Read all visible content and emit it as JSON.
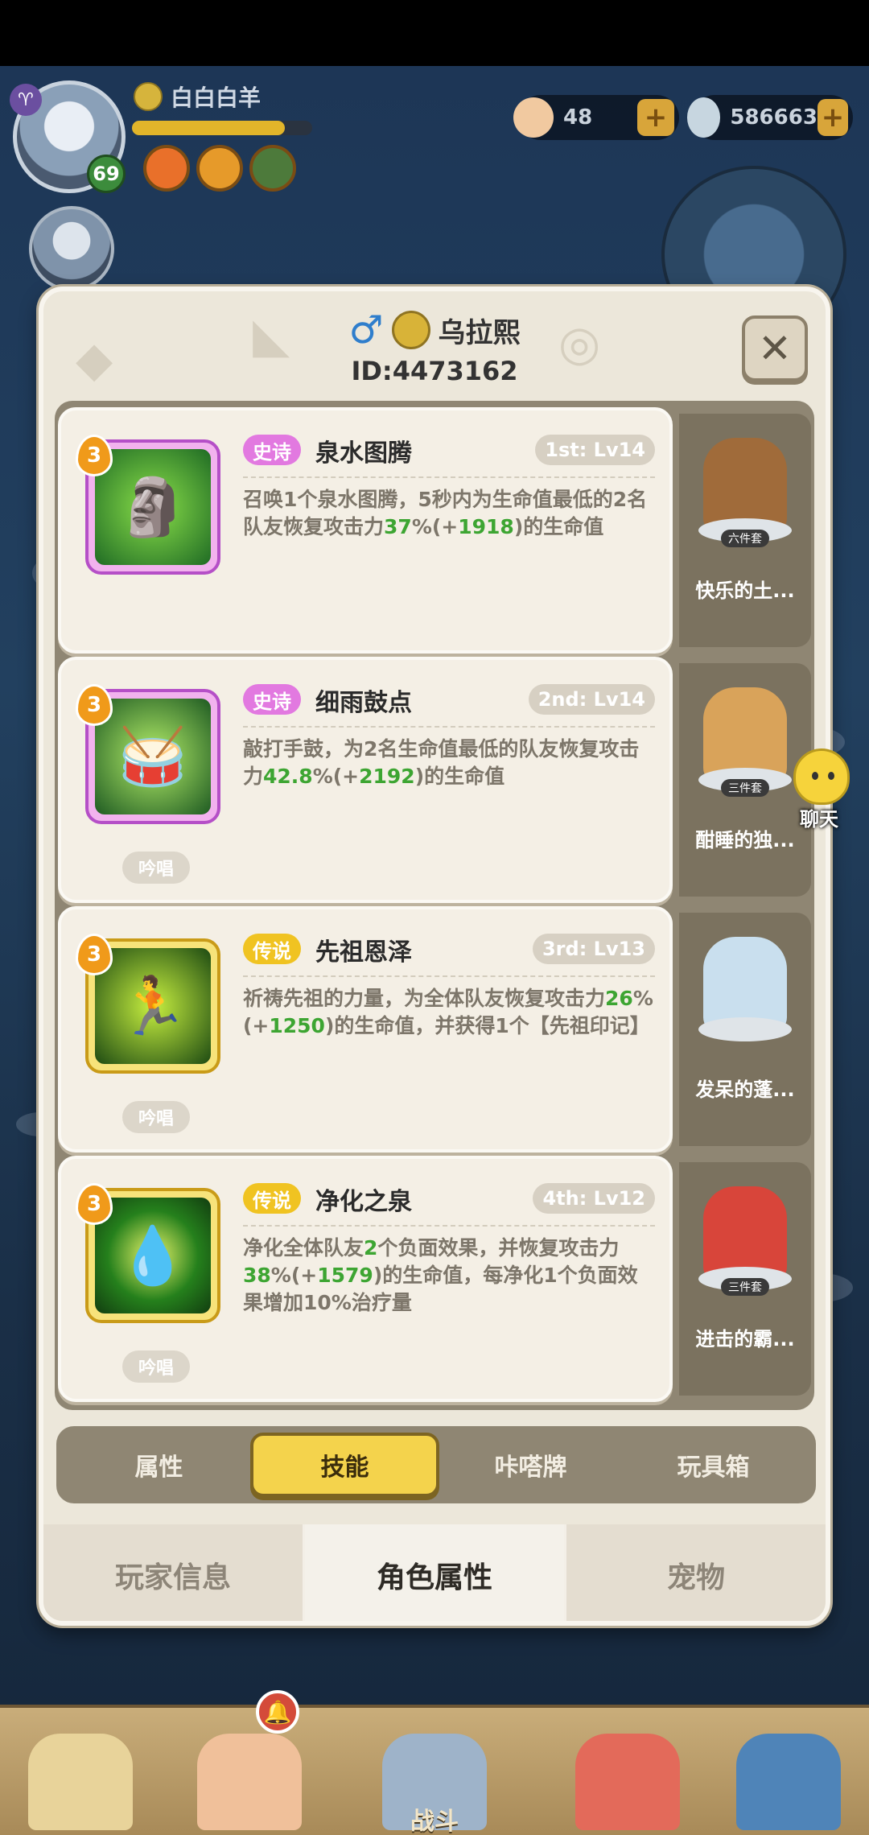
{
  "hud": {
    "player_name": "白白白羊",
    "level": "69",
    "currency_1": "48",
    "currency_2": "586663",
    "plus": "+"
  },
  "modal": {
    "gender": "♂",
    "name": "乌拉熙",
    "id": "ID:4473162",
    "close": "✕"
  },
  "skills": [
    {
      "level": "3",
      "rarity": "史诗",
      "name": "泉水图腾",
      "slot": "1st: Lv14",
      "desc_parts": [
        "召唤1个泉水图腾，5秒内为生命值最低的2名队友恢复攻击力",
        "37",
        "%(+",
        "1918",
        ")的生命值"
      ],
      "chant": "",
      "set_tag": "六件套",
      "set_name": "快乐的土..."
    },
    {
      "level": "3",
      "rarity": "史诗",
      "name": "细雨鼓点",
      "slot": "2nd: Lv14",
      "desc_parts": [
        "敲打手鼓，为2名生命值最低的队友恢复攻击力",
        "42.8",
        "%(+",
        "2192",
        ")的生命值"
      ],
      "chant": "吟唱",
      "set_tag": "三件套",
      "set_name": "酣睡的独..."
    },
    {
      "level": "3",
      "rarity": "传说",
      "name": "先祖恩泽",
      "slot": "3rd: Lv13",
      "desc_parts": [
        "祈祷先祖的力量，为全体队友恢复攻击力",
        "26",
        "%(+",
        "1250",
        ")的生命值，并获得1个【先祖印记】"
      ],
      "chant": "吟唱",
      "set_tag": "",
      "set_name": "发呆的蓬..."
    },
    {
      "level": "3",
      "rarity": "传说",
      "name": "净化之泉",
      "slot": "4th: Lv12",
      "desc_parts": [
        "净化全体队友",
        "2",
        "个负面效果，并恢复攻击力",
        "38",
        "%(+",
        "1579",
        ")的生命值，每净化1个负面效果增加10%治疗量"
      ],
      "chant": "吟唱",
      "set_tag": "三件套",
      "set_name": "进击的霸..."
    }
  ],
  "chat": {
    "label": "聊天"
  },
  "subtabs": [
    "属性",
    "技能",
    "咔嗒牌",
    "玩具箱"
  ],
  "maintabs": [
    "玩家信息",
    "角色属性",
    "宠物"
  ],
  "nav": {
    "battle": "战斗"
  },
  "colors": {
    "highlight_green": "#3da532",
    "epic": "#e279e0",
    "legend": "#f0c321",
    "active_tab": "#f4d34c"
  }
}
